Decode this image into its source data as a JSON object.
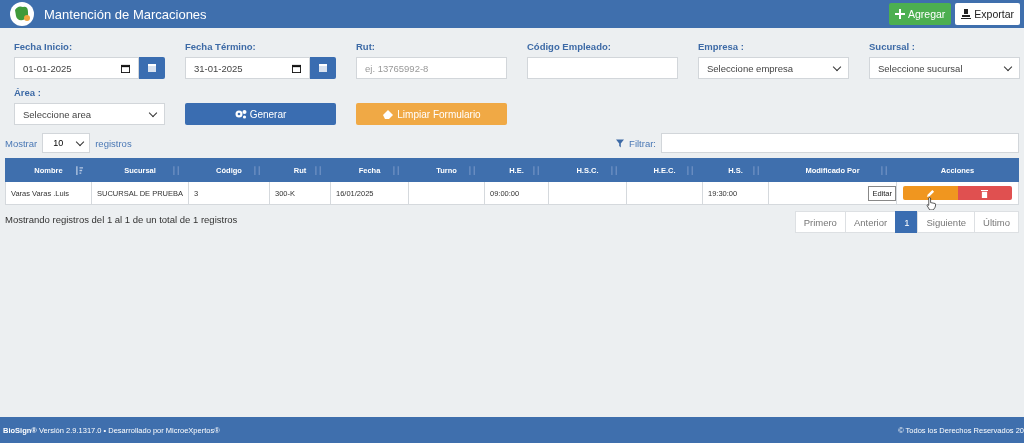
{
  "header": {
    "title": "Mantención de Marcaciones",
    "buttons": [
      {
        "label": "Agregar",
        "kind": "add"
      },
      {
        "label": "Exportar",
        "kind": "export"
      }
    ]
  },
  "filters": [
    {
      "label": "Fecha Inicio:",
      "kind": "date",
      "value": "01-01-2025"
    },
    {
      "label": "Fecha Término:",
      "kind": "date",
      "value": "31-01-2025"
    },
    {
      "label": "Rut:",
      "kind": "text",
      "placeholder": "ej. 13765992-8"
    },
    {
      "label": "Código Empleado:",
      "kind": "text"
    },
    {
      "label": "Empresa :",
      "kind": "select",
      "value": "Seleccione empresa"
    },
    {
      "label": "Sucursal :",
      "kind": "select",
      "value": "Seleccione sucursal"
    },
    {
      "label": "Área :",
      "kind": "select",
      "value": "Seleccione area"
    }
  ],
  "actions": [
    {
      "label": "Generar",
      "kind": "generate"
    },
    {
      "label": "Limpiar Formulario",
      "kind": "clear"
    }
  ],
  "length": {
    "before": "Mostrar",
    "value": "10",
    "after": "registros"
  },
  "filter": {
    "label": "Filtrar:"
  },
  "table": {
    "columns": [
      {
        "label": "Nombre",
        "sorted": true
      },
      {
        "label": "Sucursal",
        "sorted": false
      },
      {
        "label": "Código",
        "sorted": false
      },
      {
        "label": "Rut",
        "sorted": false
      },
      {
        "label": "Fecha",
        "sorted": false
      },
      {
        "label": "Turno",
        "sorted": false
      },
      {
        "label": "H.E.",
        "sorted": false
      },
      {
        "label": "H.S.C.",
        "sorted": false
      },
      {
        "label": "H.E.C.",
        "sorted": false
      },
      {
        "label": "H.S.",
        "sorted": false
      },
      {
        "label": "Modificado Por",
        "sorted": false
      },
      {
        "label": "Acciones"
      }
    ],
    "rows": [
      {
        "cells": [
          "Varas Varas .Luis",
          "SUCURSAL DE PRUEBA",
          "3",
          "300-K",
          "16/01/2025",
          "",
          "09:00:00",
          "",
          "",
          "19:30:00",
          ""
        ]
      }
    ]
  },
  "tooltip": "Editar",
  "info": "Mostrando registros del 1 al 1 de un total de 1 registros",
  "pagination": [
    {
      "label": "Primero",
      "selected": false
    },
    {
      "label": "Anterior",
      "selected": false
    },
    {
      "label": "1",
      "selected": true
    },
    {
      "label": "Siguiente",
      "selected": false
    },
    {
      "label": "Último",
      "selected": false
    }
  ],
  "footer": {
    "left": "**BioSign®** Versión 2.9.1317.0 • Desarrollado por MicroeXpertos®",
    "right": "© Todos los Derechos Reservados 20"
  }
}
